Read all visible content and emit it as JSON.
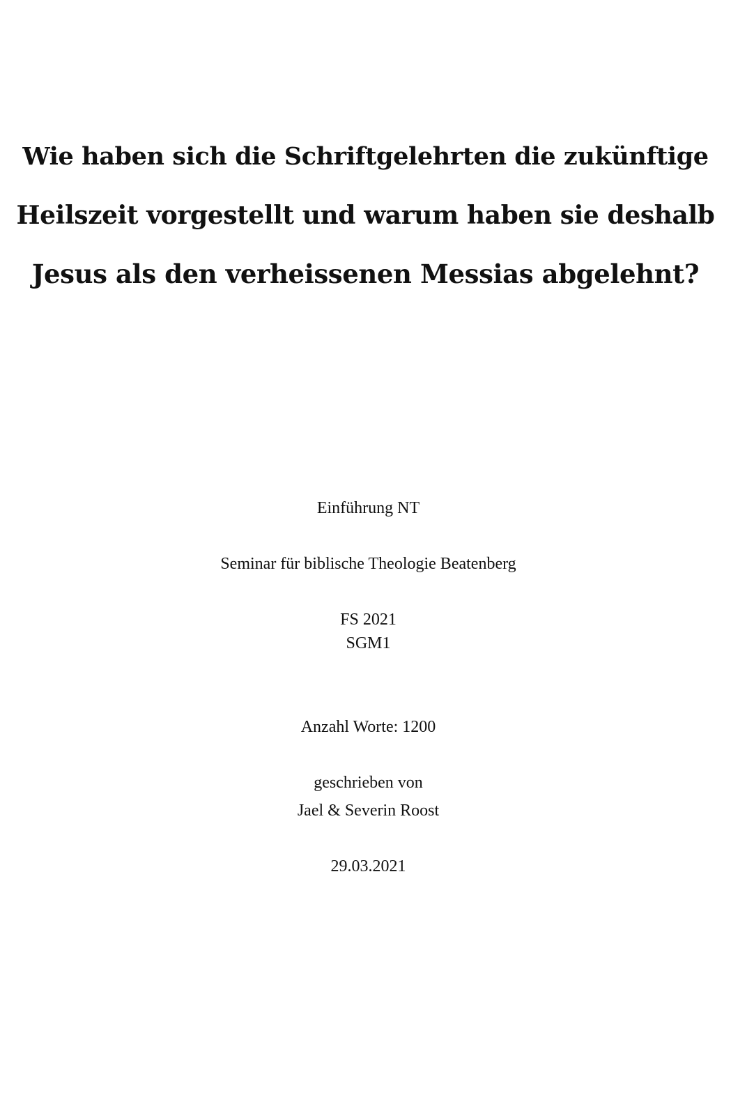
{
  "title": {
    "line1": "Wie haben sich die Schriftgelehrten die zukünftige",
    "line2": "Heilszeit vorgestellt und warum haben sie deshalb",
    "line3": "Jesus als den verheissenen Messias abgelehnt?"
  },
  "info": {
    "course": "Einführung NT",
    "seminar": "Seminar für biblische Theologie Beatenberg",
    "semester": "FS 2021",
    "group": "SGM1",
    "word_count": "Anzahl Worte: 1200",
    "byline": "geschrieben von",
    "authors": "Jael & Severin Roost",
    "date": "29.03.2021"
  }
}
